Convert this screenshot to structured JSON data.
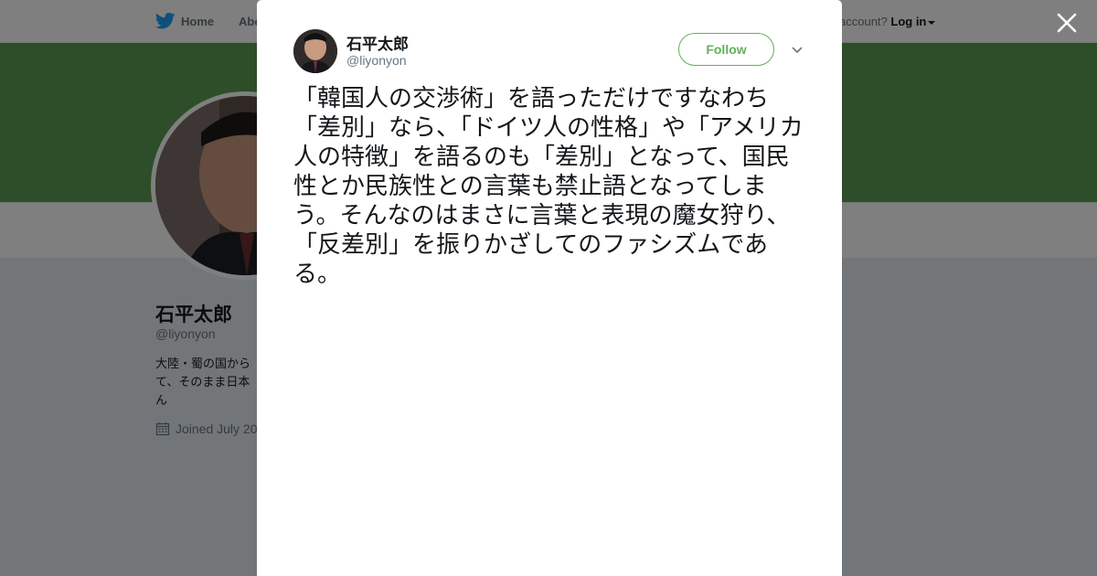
{
  "topbar": {
    "home_label": "Home",
    "about_label": "Abo",
    "login_prompt": "account?",
    "login_label": "Log in"
  },
  "profile": {
    "name": "石平太郎",
    "handle": "@liyonyon",
    "bio": "大陸・蜀の国から\nて、そのまま日本\nん",
    "joined": "Joined July 20"
  },
  "tweet": {
    "name": "石平太郎",
    "handle": "@liyonyon",
    "follow_label": "Follow",
    "text": "「韓国人の交渉術」を語っただけですなわち「差別」なら、「ドイツ人の性格」や「アメリカ人の特徴」を語るのも「差別」となって、国民性とか民族性との言葉も禁止語となってしまう。そんなのはまさに言葉と表現の魔女狩り、「反差別」を振りかざしてのファシズムである。"
  },
  "icons": {
    "bird": "twitter-bird-icon",
    "close": "close-icon",
    "chevron": "chevron-down-icon",
    "calendar": "calendar-icon"
  },
  "colors": {
    "brand": "#1da1f2",
    "banner": "#5a9c53",
    "follow": "#5fb35a"
  }
}
